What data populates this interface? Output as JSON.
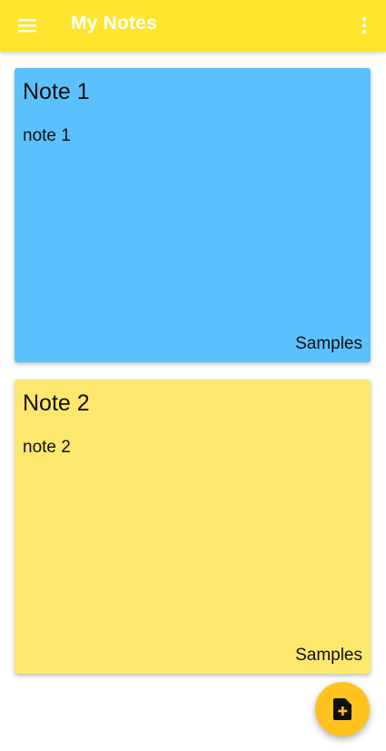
{
  "app_bar": {
    "title": "My Notes",
    "background_color": "#ffe52e",
    "menu_icon": "hamburger-menu-icon",
    "overflow_icon": "more-vertical-icon"
  },
  "notes": [
    {
      "title": "Note 1",
      "body": "note 1",
      "label": "Samples",
      "color": "#5bc1fd"
    },
    {
      "title": "Note 2",
      "body": "note 2",
      "label": "Samples",
      "color": "#fee76d"
    }
  ],
  "fab": {
    "icon": "add-note-icon",
    "color": "#ffc21e"
  }
}
